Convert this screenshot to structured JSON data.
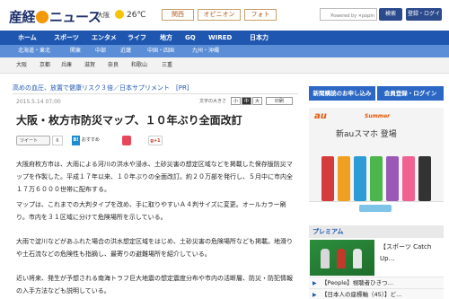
{
  "masthead": {
    "logo_text_a": "産経",
    "logo_text_b": "ニュース",
    "weather_city": "大阪",
    "weather_temp": "26℃",
    "services": [
      "関西",
      "オピニオン",
      "フォト"
    ],
    "search_credit": "Powered by ✕popIn",
    "search_label": "検索",
    "login_label": "登録・ログイン"
  },
  "nav": {
    "items": [
      "ホーム",
      "スポーツ",
      "エンタメ",
      "ライフ",
      "地方",
      "GQ",
      "WIRED",
      "日本力"
    ]
  },
  "subnav1": {
    "items": [
      "北海道・東北",
      "関東",
      "中部",
      "近畿",
      "中国・四国",
      "九州・沖縄"
    ]
  },
  "subnav2": {
    "items": [
      "大阪",
      "京都",
      "兵庫",
      "滋賀",
      "奈良",
      "和歌山",
      "三重"
    ]
  },
  "article": {
    "pr_link": "高めの血圧、放置で健康リスク３倍／日本サプリメント　[PR]",
    "date": "2015.5.14 07:00",
    "font_size_label": "文字の大きさ",
    "font_sizes": [
      "小",
      "中",
      "大"
    ],
    "print_label": "印刷",
    "headline": "大阪・枚方市防災マップ、１０年ぶり全面改訂",
    "tweet_label": "ツイート",
    "tweet_count": "6",
    "hatena_label": "B!",
    "osusume_label": "おすすめ",
    "gplus_label": "g+1",
    "paragraphs": [
      "大阪府枚方市は、大雨による河川の洪水や浸水、土砂災害の想定区域などを掲載した保存版防災マップを作製した。平成１７年以来、１０年ぶりの全面改訂。約２０万部を発行し、５月中に市内全１７万６０００世帯に配布する。",
      "マップは、これまでの大判タイプを改め、手に取りやすいＡ４判サイズに変更。オールカラー刷り。市内を３１区域に分けて危険場所を示している。",
      "大雨で淀川などがあふれた場合の洪水想定区域をはじめ、土砂災害の危険場所なども掲載。地滑りや土石流などの危険性も指摘し、最寄りの避難場所を紹介している。",
      "近い将来、発生が予想される南海トラフ巨大地震の想定震度分布や市内の活断層、防災・防犯情報の入手方法なども説明している。"
    ]
  },
  "sidebar": {
    "newspaper_button": "新聞購読のお申し込み",
    "news_register_button": "会員登録・ログイン",
    "ad": {
      "brand": "au",
      "campaign": "Summer",
      "title": "新auスマホ 登場"
    },
    "premium_title": "プレミアム",
    "premium_caption": "【スポーツ Catch Up…",
    "premium_list": [
      "【People】視聴者ひきつ…",
      "【日本人の座標軸（45）】ど…"
    ]
  },
  "colors": {
    "nav_blue": "#1f57b0",
    "subnav_blue": "#5b8ed6",
    "button_blue": "#2b67c4",
    "brand_orange": "#f39800",
    "au_orange": "#ea5504"
  },
  "icons": [
    "sun-icon",
    "search-icon",
    "arrow-right-icon"
  ]
}
